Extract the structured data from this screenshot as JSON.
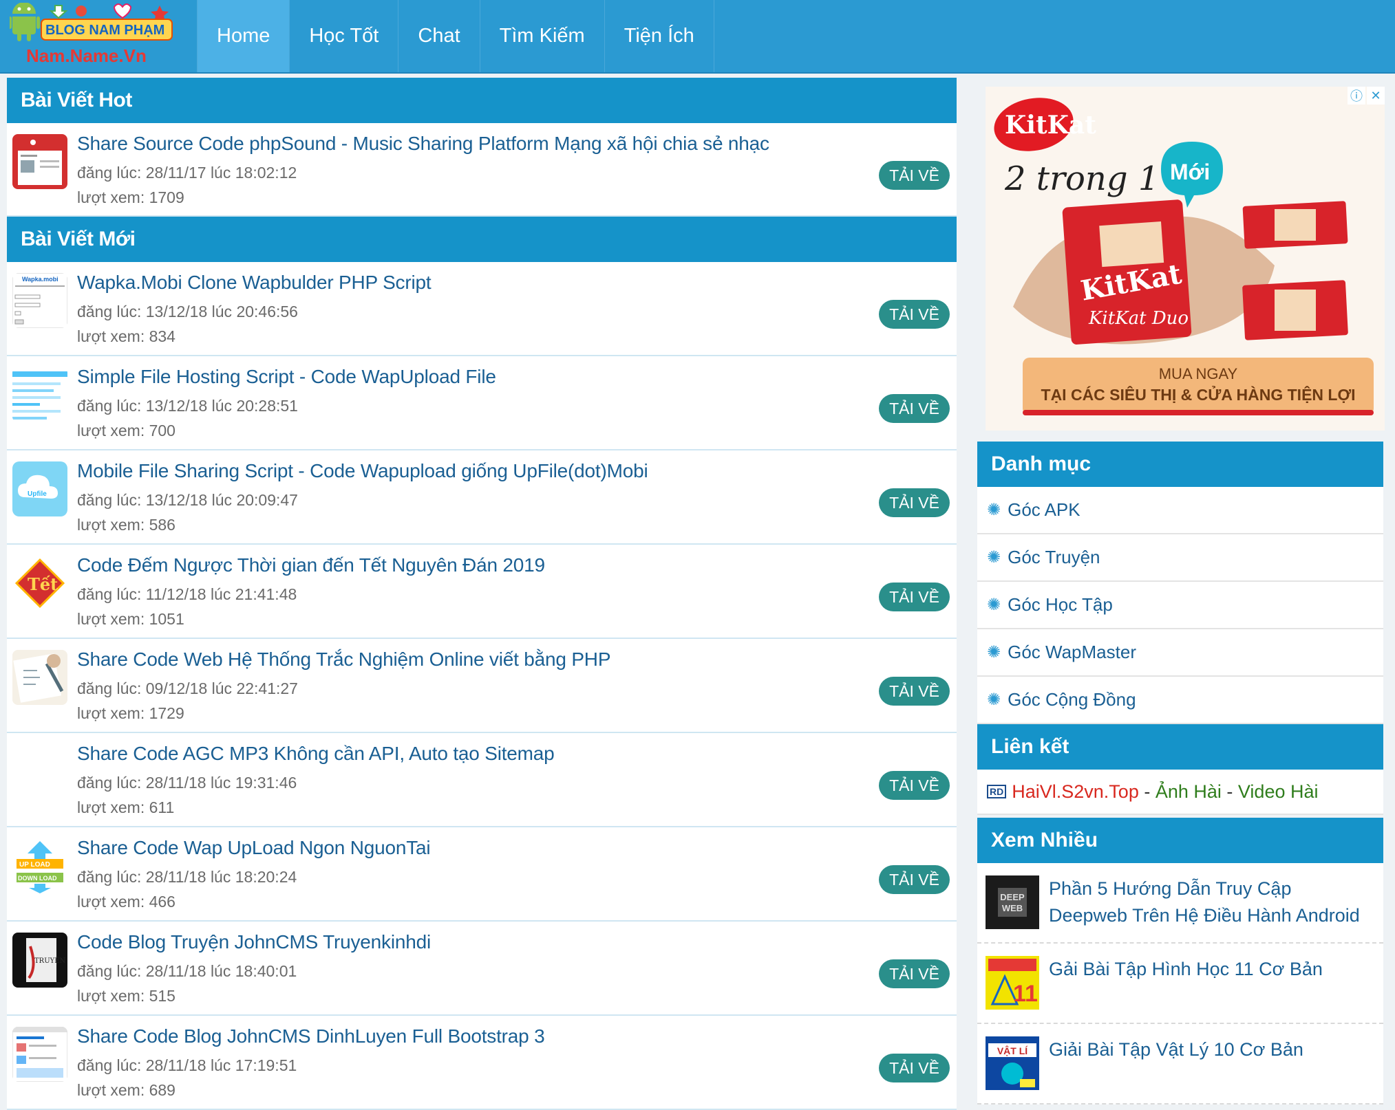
{
  "header": {
    "logo_text_top": "BLOG NAM PHẠM",
    "logo_text_bottom": "Nam.Name.Vn",
    "nav": [
      {
        "label": "Home"
      },
      {
        "label": "Học Tốt"
      },
      {
        "label": "Chat"
      },
      {
        "label": "Tìm Kiếm"
      },
      {
        "label": "Tiện Ích"
      }
    ]
  },
  "hot": {
    "heading": "Bài Viết Hot",
    "posts": [
      {
        "title": "Share Source Code phpSound - Music Sharing Platform Mạng xã hội chia sẻ nhạc",
        "date": "đăng lúc: 28/11/17 lúc 18:02:12",
        "views": "lượt xem: 1709",
        "button": "TẢI VỀ"
      }
    ]
  },
  "new": {
    "heading": "Bài Viết Mới",
    "posts": [
      {
        "title": "Wapka.Mobi Clone Wapbulder PHP Script",
        "date": "đăng lúc: 13/12/18 lúc 20:46:56",
        "views": "lượt xem: 834",
        "button": "TẢI VỀ"
      },
      {
        "title": "Simple File Hosting Script - Code WapUpload File",
        "date": "đăng lúc: 13/12/18 lúc 20:28:51",
        "views": "lượt xem: 700",
        "button": "TẢI VỀ"
      },
      {
        "title": "Mobile File Sharing Script - Code Wapupload giống UpFile(dot)Mobi",
        "date": "đăng lúc: 13/12/18 lúc 20:09:47",
        "views": "lượt xem: 586",
        "button": "TẢI VỀ"
      },
      {
        "title": "Code Đếm Ngược Thời gian đến Tết Nguyên Đán 2019",
        "date": "đăng lúc: 11/12/18 lúc 21:41:48",
        "views": "lượt xem: 1051",
        "button": "TẢI VỀ"
      },
      {
        "title": "Share Code Web Hệ Thống Trắc Nghiệm Online viết bằng PHP",
        "date": "đăng lúc: 09/12/18 lúc 22:41:27",
        "views": "lượt xem: 1729",
        "button": "TẢI VỀ"
      },
      {
        "title": "Share Code AGC MP3 Không cần API, Auto tạo Sitemap",
        "date": "đăng lúc: 28/11/18 lúc 19:31:46",
        "views": "lượt xem: 611",
        "button": "TẢI VỀ"
      },
      {
        "title": "Share Code Wap UpLoad Ngon NguonTai",
        "date": "đăng lúc: 28/11/18 lúc 18:20:24",
        "views": "lượt xem: 466",
        "button": "TẢI VỀ"
      },
      {
        "title": "Code Blog Truyện JohnCMS Truyenkinhdi",
        "date": "đăng lúc: 28/11/18 lúc 18:40:01",
        "views": "lượt xem: 515",
        "button": "TẢI VỀ"
      },
      {
        "title": "Share Code Blog JohnCMS DinhLuyen Full Bootstrap 3",
        "date": "đăng lúc: 28/11/18 lúc 17:19:51",
        "views": "lượt xem: 689",
        "button": "TẢI VỀ"
      }
    ]
  },
  "ad": {
    "brand": "KitKat",
    "tagline": "2 trong 1",
    "badge": "Mới",
    "product": "KitKat Duo",
    "cta_line1": "MUA NGAY",
    "cta_line2": "TẠI CÁC SIÊU THỊ & CỬA HÀNG TIỆN LỢI",
    "info_icon": "ⓘ",
    "close_icon": "✕"
  },
  "sidebar": {
    "categories_heading": "Danh mục",
    "categories": [
      {
        "label": "Góc APK"
      },
      {
        "label": "Góc Truyện"
      },
      {
        "label": "Góc Học Tập"
      },
      {
        "label": "Góc WapMaster"
      },
      {
        "label": "Góc Cộng Đồng"
      }
    ],
    "links_heading": "Liên kết",
    "links": {
      "badge": "RD",
      "site": "HaiVl.S2vn.Top",
      "sep1": " - ",
      "part2": "Ảnh Hài",
      "sep2": " - ",
      "part3": "Video Hài"
    },
    "popular_heading": "Xem Nhiều",
    "popular": [
      {
        "title": "Phần 5 Hướng Dẫn Truy Cập Deepweb Trên Hệ Điều Hành Android",
        "thumb_text": "DEEP WEB"
      },
      {
        "title": "Gải Bài Tập Hình Học 11 Cơ Bản",
        "thumb_text": "11"
      },
      {
        "title": "Giải Bài Tập Vật Lý 10 Cơ Bản",
        "thumb_text": "VẬT LÍ"
      }
    ]
  },
  "colors": {
    "topbar": "#2b9ad2",
    "section_header": "#1593c9",
    "link": "#1a5f93",
    "button": "#2a8f8b",
    "link_red": "#d8281f",
    "link_green": "#2f7d1c"
  }
}
